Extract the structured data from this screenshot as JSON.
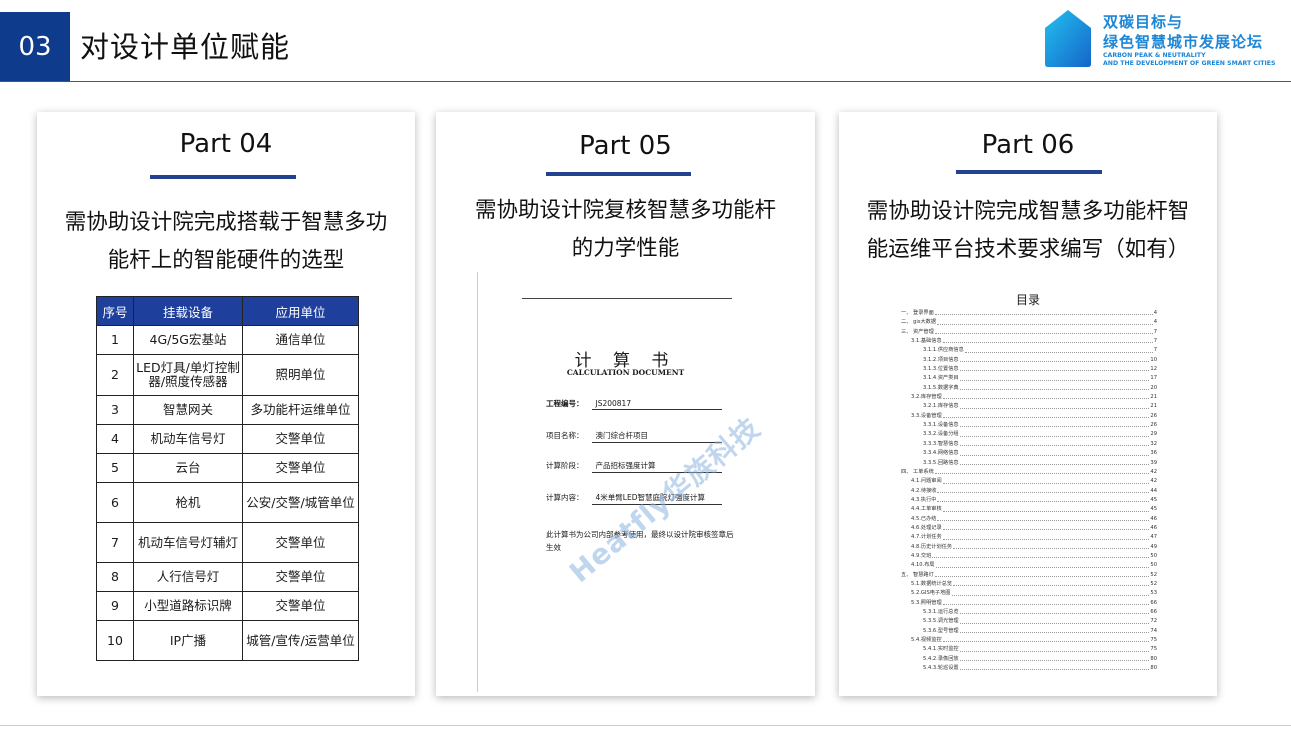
{
  "header": {
    "number": "03",
    "title": "对设计单位赋能"
  },
  "logo": {
    "line1": "双碳目标与",
    "line2": "绿色智慧城市发展论坛",
    "en1": "CARBON PEAK & NEUTRALITY",
    "en2": "AND THE DEVELOPMENT OF GREEN SMART CITIES"
  },
  "cards": [
    {
      "part": "Part 04",
      "desc_lines": [
        "需协助设计院完成搭载于智慧多功",
        "能杆上的智能硬件的选型"
      ],
      "table": {
        "headers": [
          "序号",
          "挂载设备",
          "应用单位"
        ],
        "rows": [
          [
            "1",
            "4G/5G宏基站",
            "通信单位"
          ],
          [
            "2",
            "LED灯具/单灯控制器/照度传感器",
            "照明单位"
          ],
          [
            "3",
            "智慧网关",
            "多功能杆运维单位"
          ],
          [
            "4",
            "机动车信号灯",
            "交警单位"
          ],
          [
            "5",
            "云台",
            "交警单位"
          ],
          [
            "6",
            "枪机",
            "公安/交警/城管单位"
          ],
          [
            "7",
            "机动车信号灯辅灯",
            "交警单位"
          ],
          [
            "8",
            "人行信号灯",
            "交警单位"
          ],
          [
            "9",
            "小型道路标识牌",
            "交警单位"
          ],
          [
            "10",
            "IP广播",
            "城管/宣传/运营单位"
          ]
        ]
      }
    },
    {
      "part": "Part 05",
      "desc_lines": [
        "需协助设计院复核智慧多功能杆",
        "的力学性能"
      ],
      "doc": {
        "title": "计 算 书",
        "subtitle": "CALCULATION DOCUMENT",
        "fields": [
          {
            "label": "工程编号：",
            "value": "JS200817"
          },
          {
            "label": "项目名称：",
            "value": "澳门综合杆项目"
          },
          {
            "label": "计算阶段：",
            "value": "产品招标强度计算"
          },
          {
            "label": "计算内容：",
            "value": "4米单臂LED智慧庭院灯强度计算"
          }
        ],
        "note": "此计算书为公司内部参考使用，最终以设计院审核签章后生效",
        "watermark": "Heatfly华族科技"
      }
    },
    {
      "part": "Part 06",
      "desc_lines": [
        "需协助设计院完成智慧多功能杆智",
        "能运维平台技术要求编写（如有）"
      ],
      "toc": {
        "title": "目录",
        "entries": [
          {
            "indent": 0,
            "text": "一、 登录界面",
            "page": "4"
          },
          {
            "indent": 0,
            "text": "二、 gis大数据",
            "page": "4"
          },
          {
            "indent": 0,
            "text": "三、 资产管理",
            "page": "7"
          },
          {
            "indent": 1,
            "text": "3.1.基础信息",
            "page": "7"
          },
          {
            "indent": 2,
            "text": "3.1.1.供应商信息",
            "page": "7"
          },
          {
            "indent": 2,
            "text": "3.1.2.项目信息",
            "page": "10"
          },
          {
            "indent": 2,
            "text": "3.1.3.位置信息",
            "page": "12"
          },
          {
            "indent": 2,
            "text": "3.1.4.资产类目",
            "page": "17"
          },
          {
            "indent": 2,
            "text": "3.1.5.数据字典",
            "page": "20"
          },
          {
            "indent": 1,
            "text": "3.2.库存管理",
            "page": "21"
          },
          {
            "indent": 2,
            "text": "3.2.1.库存信息",
            "page": "21"
          },
          {
            "indent": 1,
            "text": "3.3.设备管理",
            "page": "26"
          },
          {
            "indent": 2,
            "text": "3.3.1.设备信息",
            "page": "26"
          },
          {
            "indent": 2,
            "text": "3.3.2.设备分组",
            "page": "29"
          },
          {
            "indent": 2,
            "text": "3.3.3.智慧信息",
            "page": "32"
          },
          {
            "indent": 2,
            "text": "3.3.4.网络信息",
            "page": "36"
          },
          {
            "indent": 2,
            "text": "3.3.5.回路信息",
            "page": "39"
          },
          {
            "indent": 0,
            "text": "四、 工单系统",
            "page": "42"
          },
          {
            "indent": 1,
            "text": "4.1.问题审阅",
            "page": "42"
          },
          {
            "indent": 1,
            "text": "4.2.待接收",
            "page": "44"
          },
          {
            "indent": 1,
            "text": "4.3.执行中",
            "page": "45"
          },
          {
            "indent": 1,
            "text": "4.4.工单审核",
            "page": "45"
          },
          {
            "indent": 1,
            "text": "4.5.已办结",
            "page": "46"
          },
          {
            "indent": 1,
            "text": "4.6.处理记录",
            "page": "46"
          },
          {
            "indent": 1,
            "text": "4.7.计划任务",
            "page": "47"
          },
          {
            "indent": 1,
            "text": "4.8.历史计划任务",
            "page": "49"
          },
          {
            "indent": 1,
            "text": "4.9.交班",
            "page": "50"
          },
          {
            "indent": 1,
            "text": "4.10.布局",
            "page": "50"
          },
          {
            "indent": 0,
            "text": "五、 智慧路灯",
            "page": "52"
          },
          {
            "indent": 1,
            "text": "5.1.数据统计总览",
            "page": "52"
          },
          {
            "indent": 1,
            "text": "5.2.GIS电子地图",
            "page": "53"
          },
          {
            "indent": 1,
            "text": "5.3.照明管理",
            "page": "66"
          },
          {
            "indent": 2,
            "text": "5.3.1.运行总览",
            "page": "66"
          },
          {
            "indent": 2,
            "text": "5.3.5.调光管理",
            "page": "72"
          },
          {
            "indent": 2,
            "text": "5.3.6.型号管理",
            "page": "74"
          },
          {
            "indent": 1,
            "text": "5.4.视频监控",
            "page": "75"
          },
          {
            "indent": 2,
            "text": "5.4.1.实时监控",
            "page": "75"
          },
          {
            "indent": 2,
            "text": "5.4.2.录像回放",
            "page": "80"
          },
          {
            "indent": 2,
            "text": "5.4.3.轮巡设置",
            "page": "80"
          }
        ]
      }
    }
  ],
  "colors": {
    "accent": "#0f3b8c",
    "table_header": "#1f3f9c",
    "logo": "#1d86d6"
  }
}
